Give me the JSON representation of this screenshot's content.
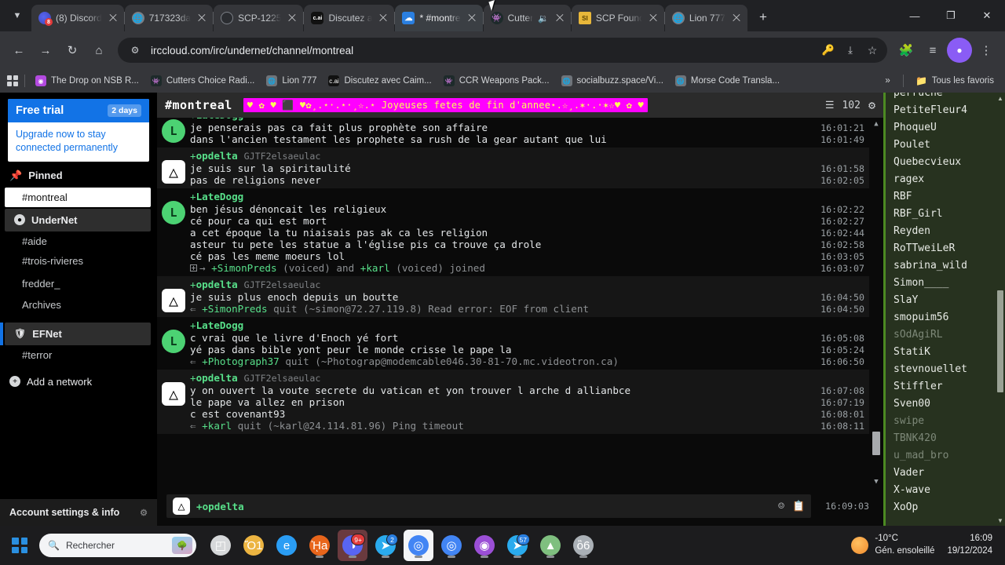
{
  "browser": {
    "tabs": [
      {
        "title": "(8) Discord",
        "favicon": "discord-icon",
        "active": false,
        "audio": false
      },
      {
        "title": "717323da",
        "favicon": "globe-icon",
        "active": false,
        "audio": false
      },
      {
        "title": "SCP-1225",
        "favicon": "scp-icon",
        "active": false,
        "audio": false
      },
      {
        "title": "Discutez a",
        "favicon": "character-ai-icon",
        "active": false,
        "audio": false
      },
      {
        "title": "* #montre",
        "favicon": "irccloud-icon",
        "active": true,
        "audio": false
      },
      {
        "title": "Cutter",
        "favicon": "cutters-icon",
        "active": false,
        "audio": true
      },
      {
        "title": "SCP Found",
        "favicon": "scp-foundation-icon",
        "active": false,
        "audio": false
      },
      {
        "title": "Lion 777",
        "favicon": "globe-icon",
        "active": false,
        "audio": false
      }
    ],
    "new_tab_label": "+",
    "window_controls": {
      "minimize": "—",
      "restore": "❐",
      "close": "✕"
    },
    "nav": {
      "back": "←",
      "forward": "→",
      "reload": "↻",
      "home": "⌂"
    },
    "omnibox": {
      "url": "irccloud.com/irc/undernet/channel/montreal",
      "site_info_icon": "page-info-icon",
      "icons": [
        "key-icon",
        "install-icon",
        "bookmark-star-icon"
      ]
    },
    "toolbar_icons": [
      "extensions-icon",
      "reading-list-icon",
      "profile-icon",
      "menu-icon"
    ],
    "bookmarks": [
      {
        "label": "The Drop on NSB R...",
        "icon": "podcast-icon"
      },
      {
        "label": "Cutters Choice Radi...",
        "icon": "cutters-icon"
      },
      {
        "label": "Lion 777",
        "icon": "globe-icon"
      },
      {
        "label": "Discutez avec Caim...",
        "icon": "character-ai-icon"
      },
      {
        "label": "CCR Weapons Pack...",
        "icon": "cutters-icon"
      },
      {
        "label": "socialbuzz.space/Vi...",
        "icon": "globe-icon"
      },
      {
        "label": "Morse Code Transla...",
        "icon": "globe-icon"
      }
    ],
    "bookmarks_overflow": "»",
    "bookmarks_all": "Tous les favoris"
  },
  "sidebar": {
    "trial": {
      "title": "Free trial",
      "badge": "2 days",
      "message": "Upgrade now to stay connected permanently"
    },
    "pinned": {
      "label": "Pinned",
      "icon": "pin-icon",
      "items": [
        "#montreal"
      ]
    },
    "networks": [
      {
        "name": "UnderNet",
        "icon": "globe-icon",
        "items": [
          "#aide",
          "#trois-rivieres",
          "fredder_",
          "Archives"
        ]
      },
      {
        "name": "EFNet",
        "icon": "shield-icon",
        "items": [
          "#terror"
        ]
      }
    ],
    "add_network": "Add a network",
    "account": "Account settings & info"
  },
  "channel": {
    "name": "#montreal",
    "topic": "♥ ✿ ♥ ⬛ ♥✿¸.⋆·.⋆·¸☆.⋆ Joyeuses fetes de fin d'annee⋆.☆¸.✶·.·✶☆♥ ✿ ♥",
    "member_count": "102",
    "member_icon": "member-list-icon",
    "settings_icon": "gear-icon"
  },
  "messages": [
    {
      "nick": "LateDogg",
      "prefix": "+",
      "realname": "",
      "avatar": "L",
      "avatar_type": "late",
      "alt": false,
      "nick_hidden": true,
      "lines": [
        {
          "type": "msg",
          "text": "je penserais pas ca fait plus prophète son affaire",
          "ts": "16:01:21"
        },
        {
          "type": "msg",
          "text": "dans l'ancien testament les prophete sa rush de la gear autant que lui",
          "ts": "16:01:49"
        }
      ]
    },
    {
      "nick": "opdelta",
      "prefix": "+",
      "realname": "GJTF2elsaeulac",
      "avatar": "△",
      "avatar_type": "op",
      "alt": true,
      "nick_hidden": false,
      "lines": [
        {
          "type": "msg",
          "text": "je suis sur la spiritaulité",
          "ts": "16:01:58"
        },
        {
          "type": "msg",
          "text": "pas de religions never",
          "ts": "16:02:05"
        }
      ]
    },
    {
      "nick": "LateDogg",
      "prefix": "+",
      "realname": "",
      "avatar": "L",
      "avatar_type": "late",
      "alt": false,
      "nick_hidden": false,
      "lines": [
        {
          "type": "msg",
          "text": "ben jésus dénoncait les religieux",
          "ts": "16:02:22"
        },
        {
          "type": "msg",
          "text": "cé pour ca qui est mort",
          "ts": "16:02:27"
        },
        {
          "type": "msg",
          "text": "a cet époque la tu niaisais pas ak ca les religion",
          "ts": "16:02:44"
        },
        {
          "type": "msg",
          "text": "asteur tu pete les statue a l'église pis ca trouve ça drole",
          "ts": "16:02:58"
        },
        {
          "type": "msg",
          "text": "cé pas les meme moeurs lol",
          "ts": "16:03:05"
        },
        {
          "type": "join",
          "text": "→ +SimonPreds (voiced) and +karl (voiced) joined",
          "ts": "16:03:07"
        }
      ]
    },
    {
      "nick": "opdelta",
      "prefix": "+",
      "realname": "GJTF2elsaeulac",
      "avatar": "△",
      "avatar_type": "op",
      "alt": true,
      "nick_hidden": false,
      "lines": [
        {
          "type": "msg",
          "text": "je suis plus enoch depuis un boutte",
          "ts": "16:04:50"
        },
        {
          "type": "quit",
          "text": "⇐ +SimonPreds quit (~simon@72.27.119.8) Read error: EOF from client",
          "ts": "16:04:50"
        }
      ]
    },
    {
      "nick": "LateDogg",
      "prefix": "+",
      "realname": "",
      "avatar": "L",
      "avatar_type": "late",
      "alt": false,
      "nick_hidden": false,
      "lines": [
        {
          "type": "msg",
          "text": "c vrai que le livre d'Enoch yé fort",
          "ts": "16:05:08"
        },
        {
          "type": "msg",
          "text": "yé pas dans bible yont peur le monde crisse le pape la",
          "ts": "16:05:24"
        },
        {
          "type": "quit",
          "text": "⇐ +Photograph37 quit (~Photograp@modemcable046.30-81-70.mc.videotron.ca)",
          "ts": "16:06:50"
        }
      ]
    },
    {
      "nick": "opdelta",
      "prefix": "+",
      "realname": "GJTF2elsaeulac",
      "avatar": "△",
      "avatar_type": "op",
      "alt": true,
      "nick_hidden": false,
      "lines": [
        {
          "type": "msg",
          "text": "y on ouvert la voute secrete du vatican et yon trouver l arche d allianbce",
          "ts": "16:07:08"
        },
        {
          "type": "msg",
          "text": "le pape va allez en prison",
          "ts": "16:07:19"
        },
        {
          "type": "msg",
          "text": "c est covenant93",
          "ts": "16:08:01"
        },
        {
          "type": "quit",
          "text": "⇐ +karl quit (~karl@24.114.81.96) Ping timeout",
          "ts": "16:08:11"
        }
      ]
    }
  ],
  "composer": {
    "nick": "opdelta",
    "prefix": "+",
    "avatar": "△",
    "placeholder": "",
    "emoji_icon": "emoji-icon",
    "paste_icon": "paste-icon",
    "timestamp": "16:09:03"
  },
  "userlist": [
    {
      "name": "perruche",
      "away": false
    },
    {
      "name": "PetiteFleur4",
      "away": false
    },
    {
      "name": "PhoqueU",
      "away": false
    },
    {
      "name": "Poulet",
      "away": false
    },
    {
      "name": "Quebecvieux",
      "away": false
    },
    {
      "name": "ragex",
      "away": false
    },
    {
      "name": "RBF",
      "away": false
    },
    {
      "name": "RBF_Girl",
      "away": false
    },
    {
      "name": "Reyden",
      "away": false
    },
    {
      "name": "RoTTweiLeR",
      "away": false
    },
    {
      "name": "sabrina_wild",
      "away": false
    },
    {
      "name": "Simon____",
      "away": false
    },
    {
      "name": "SlaY",
      "away": false
    },
    {
      "name": "smopuim56",
      "away": false
    },
    {
      "name": "sOdAgiRL",
      "away": true
    },
    {
      "name": "StatiK",
      "away": false
    },
    {
      "name": "stevnouellet",
      "away": false
    },
    {
      "name": "Stiffler",
      "away": false
    },
    {
      "name": "Sven00",
      "away": false
    },
    {
      "name": "swipe",
      "away": true
    },
    {
      "name": "TBNK420",
      "away": true
    },
    {
      "name": "u_mad_bro",
      "away": true
    },
    {
      "name": "Vader",
      "away": false
    },
    {
      "name": "X-wave",
      "away": false
    },
    {
      "name": "XoOp",
      "away": false
    }
  ],
  "taskbar": {
    "search_placeholder": "Rechercher",
    "apps": [
      {
        "name": "task-view",
        "glyph": "◰",
        "color": "#d6d8da",
        "badge": "",
        "dot": false,
        "hl": ""
      },
      {
        "name": "file-explorer",
        "glyph": "Ὄ1",
        "color": "#ecb441",
        "badge": "",
        "dot": false,
        "hl": ""
      },
      {
        "name": "edge",
        "glyph": "e",
        "color": "#2a9df4",
        "badge": "",
        "dot": false,
        "hl": ""
      },
      {
        "name": "firefox",
        "glyph": "ᾘa",
        "color": "#e8651b",
        "badge": "",
        "dot": true,
        "hl": ""
      },
      {
        "name": "discord",
        "glyph": "◑",
        "color": "#5865f2",
        "badge": "9+",
        "dot": true,
        "hl": "hl"
      },
      {
        "name": "telegram-desktop",
        "glyph": "➤",
        "color": "#2aabee",
        "badge": "2",
        "dot": true,
        "hl": ""
      },
      {
        "name": "chrome",
        "glyph": "◎",
        "color": "#4285f4",
        "badge": "",
        "dot": true,
        "hl": "hl2"
      },
      {
        "name": "chrome-2",
        "glyph": "◎",
        "color": "#4285f4",
        "badge": "",
        "dot": true,
        "hl": ""
      },
      {
        "name": "vlc-or-media",
        "glyph": "◉",
        "color": "#9b4fd6",
        "badge": "",
        "dot": true,
        "hl": ""
      },
      {
        "name": "telegram",
        "glyph": "➤",
        "color": "#2aabee",
        "badge": "57",
        "dot": true,
        "hl": ""
      },
      {
        "name": "app-green",
        "glyph": "▲",
        "color": "#7fbf7f",
        "badge": "",
        "dot": true,
        "hl": ""
      },
      {
        "name": "app-bird",
        "glyph": "ὂ6",
        "color": "#aab0b6",
        "badge": "",
        "dot": true,
        "hl": ""
      }
    ],
    "weather": {
      "temp": "-10°C",
      "desc": "Gén. ensoleillé"
    },
    "clock": {
      "time": "16:09",
      "date": "19/12/2024"
    }
  }
}
